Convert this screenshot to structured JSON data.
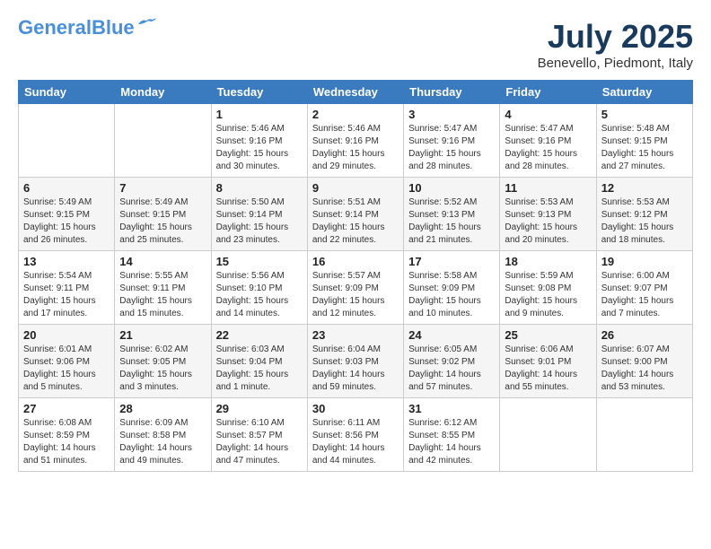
{
  "header": {
    "logo_line1": "General",
    "logo_line2": "Blue",
    "month": "July 2025",
    "location": "Benevello, Piedmont, Italy"
  },
  "days_of_week": [
    "Sunday",
    "Monday",
    "Tuesday",
    "Wednesday",
    "Thursday",
    "Friday",
    "Saturday"
  ],
  "weeks": [
    [
      {
        "day": "",
        "text": ""
      },
      {
        "day": "",
        "text": ""
      },
      {
        "day": "1",
        "text": "Sunrise: 5:46 AM\nSunset: 9:16 PM\nDaylight: 15 hours\nand 30 minutes."
      },
      {
        "day": "2",
        "text": "Sunrise: 5:46 AM\nSunset: 9:16 PM\nDaylight: 15 hours\nand 29 minutes."
      },
      {
        "day": "3",
        "text": "Sunrise: 5:47 AM\nSunset: 9:16 PM\nDaylight: 15 hours\nand 28 minutes."
      },
      {
        "day": "4",
        "text": "Sunrise: 5:47 AM\nSunset: 9:16 PM\nDaylight: 15 hours\nand 28 minutes."
      },
      {
        "day": "5",
        "text": "Sunrise: 5:48 AM\nSunset: 9:15 PM\nDaylight: 15 hours\nand 27 minutes."
      }
    ],
    [
      {
        "day": "6",
        "text": "Sunrise: 5:49 AM\nSunset: 9:15 PM\nDaylight: 15 hours\nand 26 minutes."
      },
      {
        "day": "7",
        "text": "Sunrise: 5:49 AM\nSunset: 9:15 PM\nDaylight: 15 hours\nand 25 minutes."
      },
      {
        "day": "8",
        "text": "Sunrise: 5:50 AM\nSunset: 9:14 PM\nDaylight: 15 hours\nand 23 minutes."
      },
      {
        "day": "9",
        "text": "Sunrise: 5:51 AM\nSunset: 9:14 PM\nDaylight: 15 hours\nand 22 minutes."
      },
      {
        "day": "10",
        "text": "Sunrise: 5:52 AM\nSunset: 9:13 PM\nDaylight: 15 hours\nand 21 minutes."
      },
      {
        "day": "11",
        "text": "Sunrise: 5:53 AM\nSunset: 9:13 PM\nDaylight: 15 hours\nand 20 minutes."
      },
      {
        "day": "12",
        "text": "Sunrise: 5:53 AM\nSunset: 9:12 PM\nDaylight: 15 hours\nand 18 minutes."
      }
    ],
    [
      {
        "day": "13",
        "text": "Sunrise: 5:54 AM\nSunset: 9:11 PM\nDaylight: 15 hours\nand 17 minutes."
      },
      {
        "day": "14",
        "text": "Sunrise: 5:55 AM\nSunset: 9:11 PM\nDaylight: 15 hours\nand 15 minutes."
      },
      {
        "day": "15",
        "text": "Sunrise: 5:56 AM\nSunset: 9:10 PM\nDaylight: 15 hours\nand 14 minutes."
      },
      {
        "day": "16",
        "text": "Sunrise: 5:57 AM\nSunset: 9:09 PM\nDaylight: 15 hours\nand 12 minutes."
      },
      {
        "day": "17",
        "text": "Sunrise: 5:58 AM\nSunset: 9:09 PM\nDaylight: 15 hours\nand 10 minutes."
      },
      {
        "day": "18",
        "text": "Sunrise: 5:59 AM\nSunset: 9:08 PM\nDaylight: 15 hours\nand 9 minutes."
      },
      {
        "day": "19",
        "text": "Sunrise: 6:00 AM\nSunset: 9:07 PM\nDaylight: 15 hours\nand 7 minutes."
      }
    ],
    [
      {
        "day": "20",
        "text": "Sunrise: 6:01 AM\nSunset: 9:06 PM\nDaylight: 15 hours\nand 5 minutes."
      },
      {
        "day": "21",
        "text": "Sunrise: 6:02 AM\nSunset: 9:05 PM\nDaylight: 15 hours\nand 3 minutes."
      },
      {
        "day": "22",
        "text": "Sunrise: 6:03 AM\nSunset: 9:04 PM\nDaylight: 15 hours\nand 1 minute."
      },
      {
        "day": "23",
        "text": "Sunrise: 6:04 AM\nSunset: 9:03 PM\nDaylight: 14 hours\nand 59 minutes."
      },
      {
        "day": "24",
        "text": "Sunrise: 6:05 AM\nSunset: 9:02 PM\nDaylight: 14 hours\nand 57 minutes."
      },
      {
        "day": "25",
        "text": "Sunrise: 6:06 AM\nSunset: 9:01 PM\nDaylight: 14 hours\nand 55 minutes."
      },
      {
        "day": "26",
        "text": "Sunrise: 6:07 AM\nSunset: 9:00 PM\nDaylight: 14 hours\nand 53 minutes."
      }
    ],
    [
      {
        "day": "27",
        "text": "Sunrise: 6:08 AM\nSunset: 8:59 PM\nDaylight: 14 hours\nand 51 minutes."
      },
      {
        "day": "28",
        "text": "Sunrise: 6:09 AM\nSunset: 8:58 PM\nDaylight: 14 hours\nand 49 minutes."
      },
      {
        "day": "29",
        "text": "Sunrise: 6:10 AM\nSunset: 8:57 PM\nDaylight: 14 hours\nand 47 minutes."
      },
      {
        "day": "30",
        "text": "Sunrise: 6:11 AM\nSunset: 8:56 PM\nDaylight: 14 hours\nand 44 minutes."
      },
      {
        "day": "31",
        "text": "Sunrise: 6:12 AM\nSunset: 8:55 PM\nDaylight: 14 hours\nand 42 minutes."
      },
      {
        "day": "",
        "text": ""
      },
      {
        "day": "",
        "text": ""
      }
    ]
  ]
}
